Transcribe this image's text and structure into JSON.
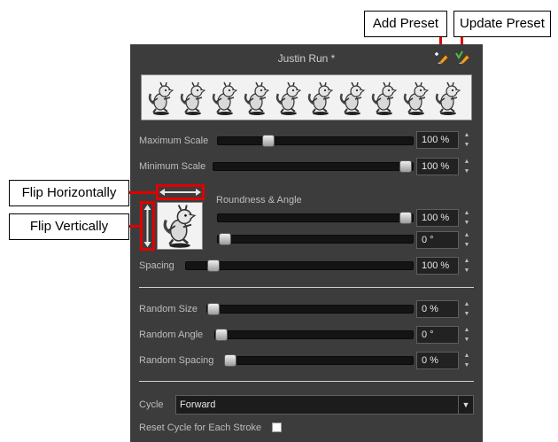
{
  "callouts": {
    "add_preset": "Add Preset",
    "update_preset": "Update Preset",
    "flip_horizontally": "Flip Horizontally",
    "flip_vertically": "Flip Vertically"
  },
  "panel": {
    "title": "Justin Run *",
    "header_icons": [
      "add-preset-icon",
      "update-preset-icon"
    ]
  },
  "scale": {
    "maximum_label": "Maximum Scale",
    "maximum_value": "100 %",
    "minimum_label": "Minimum Scale",
    "minimum_value": "100 %"
  },
  "roundness": {
    "label": "Roundness & Angle",
    "roundness_value": "100 %",
    "angle_value": "0 °"
  },
  "spacing": {
    "label": "Spacing",
    "value": "100 %"
  },
  "random": {
    "size_label": "Random Size",
    "size_value": "0 %",
    "angle_label": "Random Angle",
    "angle_value": "0 °",
    "spacing_label": "Random Spacing",
    "spacing_value": "0 %"
  },
  "cycle": {
    "label": "Cycle",
    "selected": "Forward",
    "reset_label": "Reset Cycle for Each Stroke",
    "reset_checked": false
  },
  "colors": {
    "panel_bg": "#3c3c3c",
    "highlight": "#e00000"
  }
}
